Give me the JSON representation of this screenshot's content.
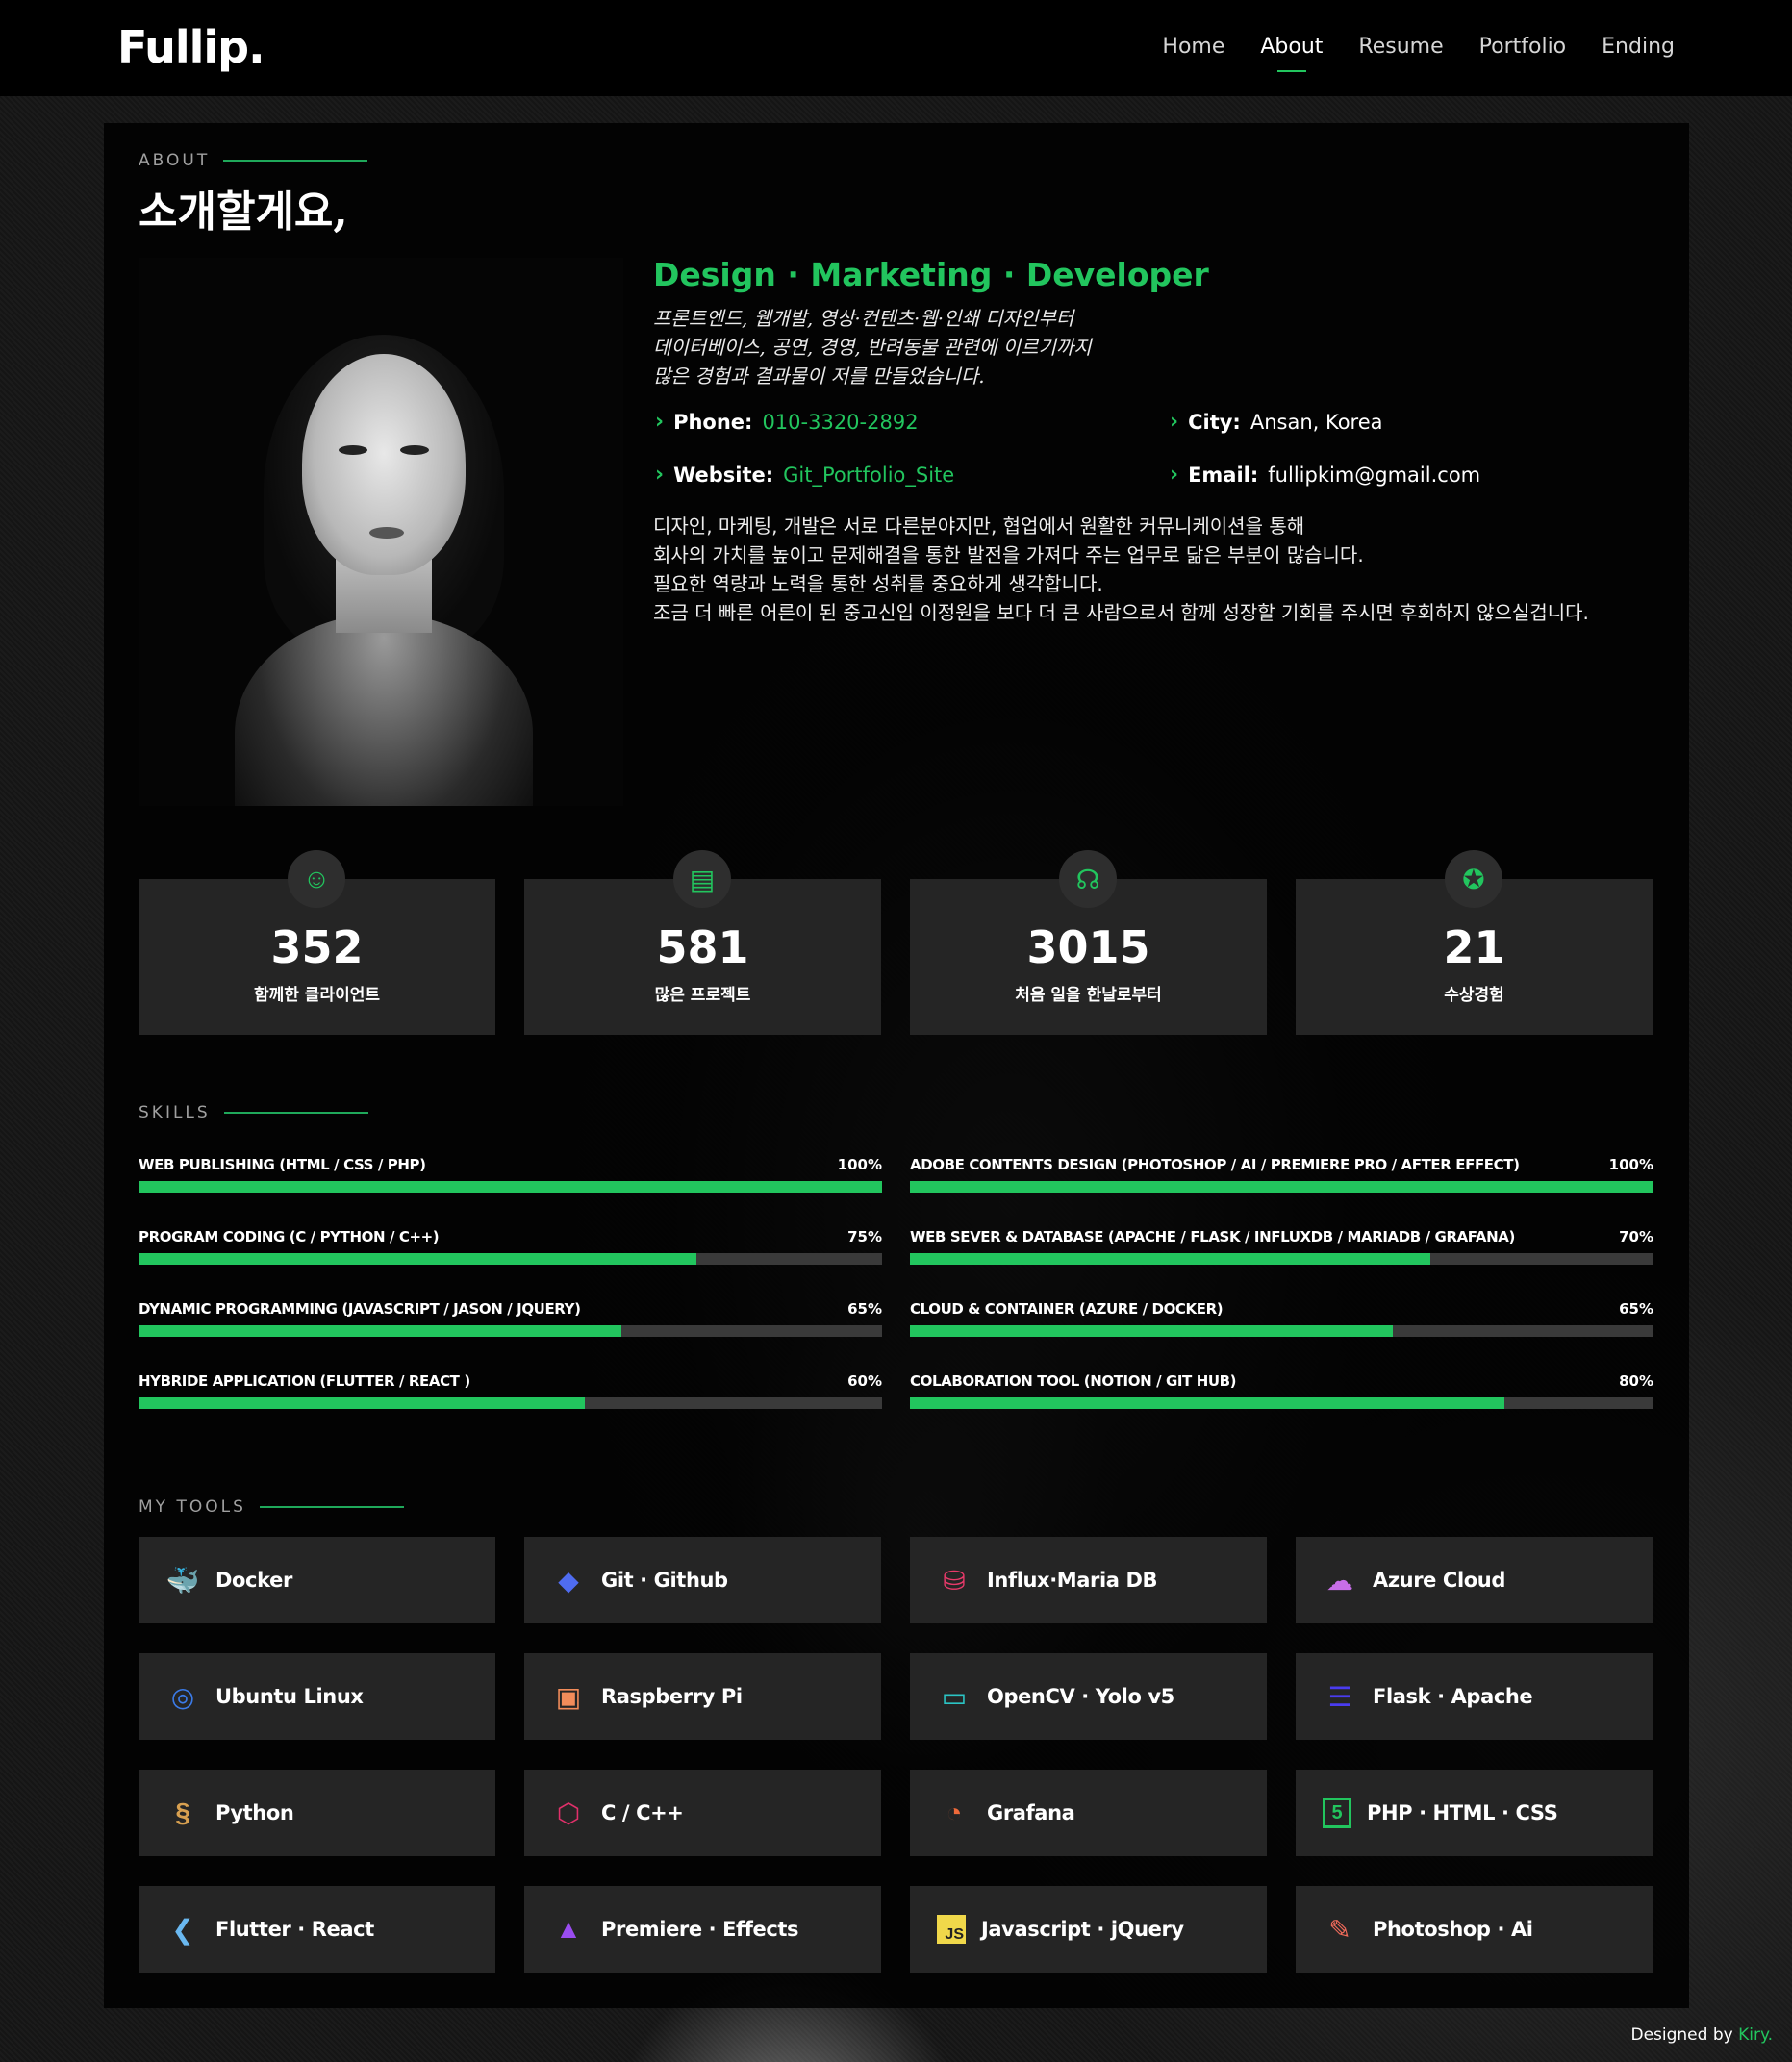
{
  "brand": {
    "logo": "Fullip."
  },
  "nav": {
    "items": [
      {
        "label": "Home"
      },
      {
        "label": "About"
      },
      {
        "label": "Resume"
      },
      {
        "label": "Portfolio"
      },
      {
        "label": "Ending"
      }
    ],
    "active": "About"
  },
  "about": {
    "section_label": "ABOUT",
    "title": "소개할게요,",
    "role": "Design · Marketing · Developer",
    "intro_lines": [
      "프론트엔드, 웹개발, 영상·컨텐츠·웹·인쇄 디자인부터",
      "데이터베이스, 공연, 경영, 반려동물 관련에 이르기까지",
      "많은 경험과 결과물이 저를 만들었습니다."
    ],
    "info": {
      "phone_label": "Phone:",
      "phone": "010-3320-2892",
      "city_label": "City:",
      "city": "Ansan, Korea",
      "website_label": "Website:",
      "website": "Git_Portfolio_Site",
      "email_label": "Email:",
      "email": "fullipkim@gmail.com"
    },
    "desc_lines": [
      "디자인, 마케팅, 개발은 서로 다른분야지만, 협업에서 원활한 커뮤니케이션을 통해",
      "회사의 가치를 높이고 문제해결을 통한 발전을 가져다 주는 업무로 닮은 부분이 많습니다.",
      "필요한 역량과 노력을 통한 성취를 중요하게 생각합니다.",
      "조금 더 빠른 어른이 된 중고신입 이정원을 보다 더 큰 사람으로서 함께 성장할 기회를 주시면 후회하지 않으실겁니다."
    ]
  },
  "stats": [
    {
      "icon": "smiley-icon",
      "value": "352",
      "label": "함께한 클라이언트"
    },
    {
      "icon": "journal-icon",
      "value": "581",
      "label": "많은 프로젝트"
    },
    {
      "icon": "headset-icon",
      "value": "3015",
      "label": "처음 일을 한날로부터"
    },
    {
      "icon": "award-icon",
      "value": "21",
      "label": "수상경험"
    }
  ],
  "skills": {
    "section_label": "SKILLS",
    "items": [
      {
        "name": "WEB PUBLISHING (HTML / CSS / PHP)",
        "percent_label": "100%",
        "value": 100
      },
      {
        "name": "ADOBE CONTENTS DESIGN (PHOTOSHOP / AI / PREMIERE PRO / AFTER EFFECT)",
        "percent_label": "100%",
        "value": 100
      },
      {
        "name": "PROGRAM CODING (C / PYTHON / C++)",
        "percent_label": "75%",
        "value": 75
      },
      {
        "name": "WEB SEVER & DATABASE (APACHE / FLASK / INFLUXDB / MARIADB / GRAFANA)",
        "percent_label": "70%",
        "value": 70
      },
      {
        "name": "DYNAMIC PROGRAMMING (JAVASCRIPT / JASON / JQUERY)",
        "percent_label": "65%",
        "value": 65
      },
      {
        "name": "CLOUD & CONTAINER (AZURE / DOCKER)",
        "percent_label": "65%",
        "value": 65
      },
      {
        "name": "HYBRIDE APPLICATION (FLUTTER / REACT )",
        "percent_label": "60%",
        "value": 60
      },
      {
        "name": "COLABORATION TOOL (NOTION / GIT HUB)",
        "percent_label": "80%",
        "value": 80
      }
    ]
  },
  "tools": {
    "section_label": "MY TOOLS",
    "items": [
      {
        "name": "Docker",
        "icon": "docker-icon",
        "color": "#f0a830"
      },
      {
        "name": "Git · Github",
        "icon": "git-icon",
        "color": "#4f6cf0"
      },
      {
        "name": "Influx·Maria DB",
        "icon": "database-icon",
        "color": "#e83a6a"
      },
      {
        "name": "Azure Cloud",
        "icon": "cloud-icon",
        "color": "#c86ee8"
      },
      {
        "name": "Ubuntu Linux",
        "icon": "ubuntu-icon",
        "color": "#3b7be8"
      },
      {
        "name": "Raspberry Pi",
        "icon": "raspberry-icon",
        "color": "#f28c5a"
      },
      {
        "name": "OpenCV · Yolo v5",
        "icon": "window-icon",
        "color": "#2bc4c4"
      },
      {
        "name": "Flask · Apache",
        "icon": "server-icon",
        "color": "#4a3cf0"
      },
      {
        "name": "Python",
        "icon": "python-icon",
        "color": "#d8a050"
      },
      {
        "name": "C / C++",
        "icon": "cpp-icon",
        "color": "#e0306a"
      },
      {
        "name": "Grafana",
        "icon": "gauge-icon",
        "color": "#f06a3a"
      },
      {
        "name": "PHP · HTML · CSS",
        "icon": "html5-icon",
        "color": "#22c55e"
      },
      {
        "name": "Flutter · React",
        "icon": "flutter-icon",
        "color": "#6ab8f0"
      },
      {
        "name": "Premiere · Effects",
        "icon": "premiere-icon",
        "color": "#9a4cf0"
      },
      {
        "name": "Javascript · jQuery",
        "icon": "javascript-icon",
        "color": "#f0d84a"
      },
      {
        "name": "Photoshop · Ai",
        "icon": "edit-icon",
        "color": "#f06a5a"
      }
    ]
  },
  "footer": {
    "prefix": "Designed by ",
    "author": "Kiry."
  }
}
